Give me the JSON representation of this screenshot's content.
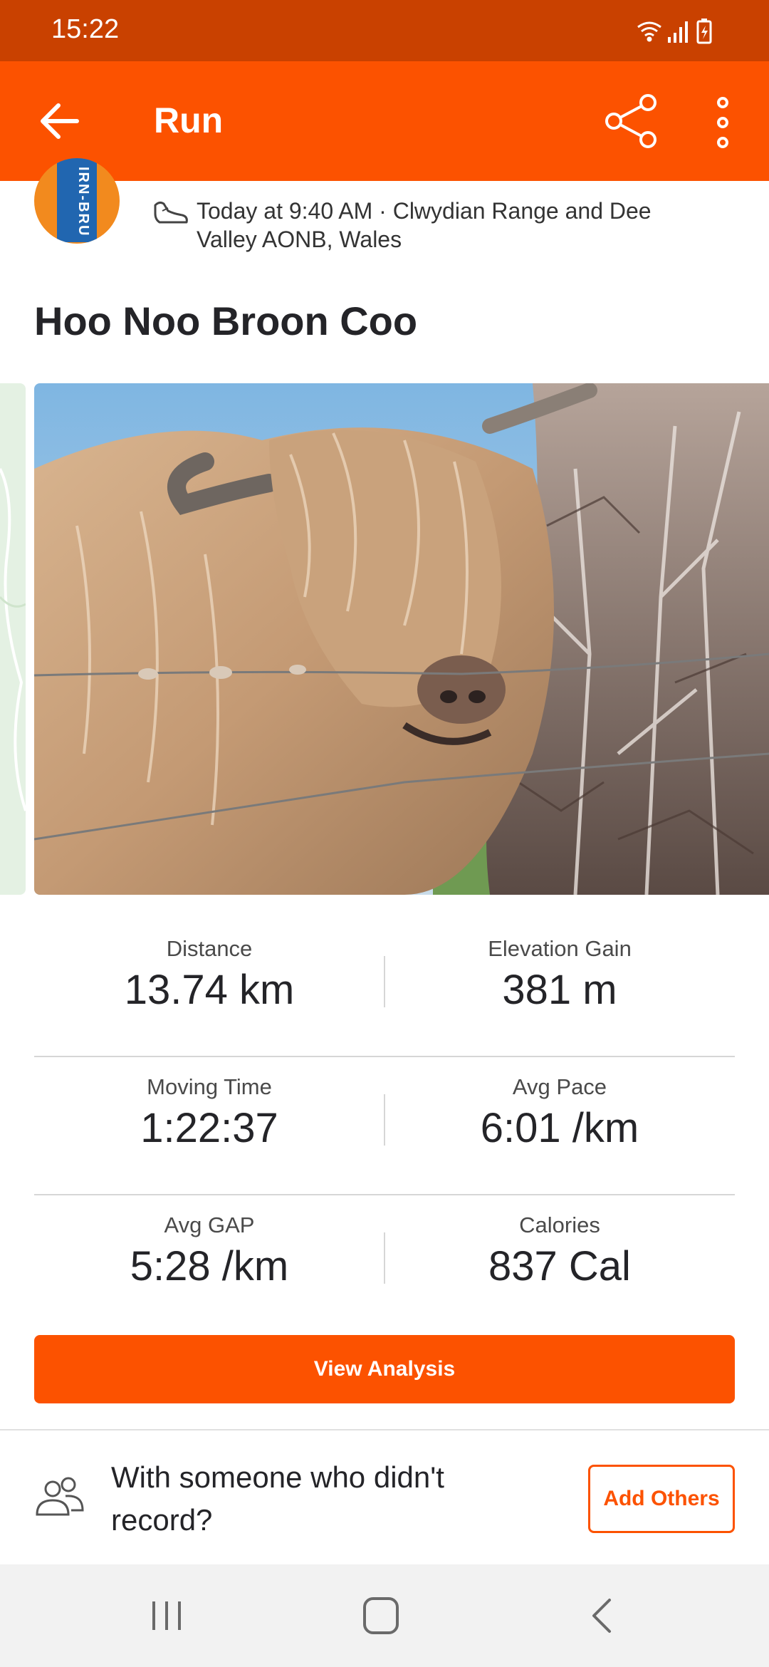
{
  "status_bar": {
    "time": "15:22"
  },
  "app_bar": {
    "title": "Run"
  },
  "activity": {
    "avatar_text": "IRN-BRU",
    "meta": "Today at 9:40 AM · Clwydian Range and Dee Valley AONB, Wales",
    "title": "Hoo Noo Broon Coo"
  },
  "stats": [
    {
      "left_label": "Distance",
      "left_value": "13.74 km",
      "right_label": "Elevation Gain",
      "right_value": "381 m"
    },
    {
      "left_label": "Moving Time",
      "left_value": "1:22:37",
      "right_label": "Avg Pace",
      "right_value": "6:01 /km"
    },
    {
      "left_label": "Avg GAP",
      "left_value": "5:28 /km",
      "right_label": "Calories",
      "right_value": "837 Cal"
    }
  ],
  "actions": {
    "view_analysis": "View Analysis",
    "with_someone": "With someone who didn't record?",
    "add_others": "Add Others"
  },
  "colors": {
    "brand": "#fc5200",
    "status_bar": "#c94100"
  },
  "icons": [
    "back-arrow-icon",
    "share-icon",
    "more-vert-icon",
    "shoe-icon",
    "people-icon",
    "wifi-icon",
    "signal-icon",
    "battery-icon",
    "nav-recents-icon",
    "nav-home-icon",
    "nav-back-icon"
  ]
}
